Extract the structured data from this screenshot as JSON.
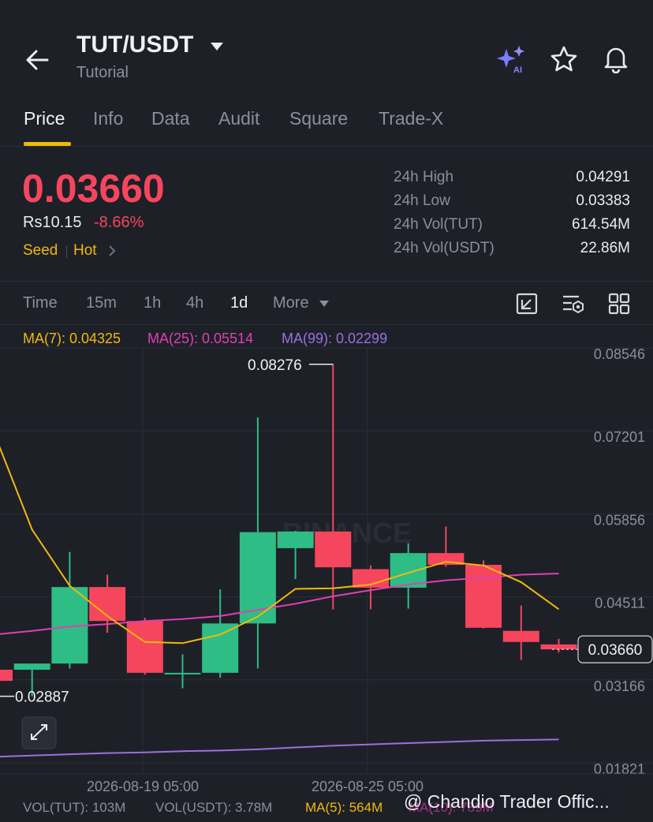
{
  "header": {
    "back_icon": "arrow-left-icon",
    "pair": "TUT/USDT",
    "subtitle": "Tutorial",
    "icons": [
      "ai-sparkle-icon",
      "star-icon",
      "bell-icon"
    ]
  },
  "tabs": [
    {
      "label": "Price",
      "active": true
    },
    {
      "label": "Info"
    },
    {
      "label": "Data"
    },
    {
      "label": "Audit"
    },
    {
      "label": "Square"
    },
    {
      "label": "Trade-X"
    }
  ],
  "price": {
    "last": "0.03660",
    "fiat": "Rs10.15",
    "change": "-8.66%",
    "tag_seed": "Seed",
    "tag_hot": "Hot"
  },
  "stats": [
    {
      "label": "24h High",
      "value": "0.04291"
    },
    {
      "label": "24h Low",
      "value": "0.03383"
    },
    {
      "label": "24h Vol(TUT)",
      "value": "614.54M"
    },
    {
      "label": "24h Vol(USDT)",
      "value": "22.86M"
    }
  ],
  "intervals": [
    {
      "label": "Time"
    },
    {
      "label": "15m"
    },
    {
      "label": "1h"
    },
    {
      "label": "4h"
    },
    {
      "label": "1d",
      "active": true
    },
    {
      "label": "More"
    }
  ],
  "ma_legend": {
    "ma7": "MA(7): 0.04325",
    "ma25": "MA(25): 0.05514",
    "ma99": "MA(99): 0.02299"
  },
  "colors": {
    "up": "#2ebd85",
    "down": "#f6465d",
    "ma7": "#f0b90b",
    "ma25": "#e040b0",
    "ma99": "#9b6fe0",
    "accent": "#f0b90b"
  },
  "chart_data": {
    "type": "candlestick",
    "y_ticks": [
      "0.08546",
      "0.07201",
      "0.05856",
      "0.04511",
      "0.03166",
      "0.01821"
    ],
    "x_ticks": [
      "2026-08-19 05:00",
      "2026-08-25 05:00"
    ],
    "ylim": [
      0.01821,
      0.08546
    ],
    "current_price_label": "0.03660",
    "high_label": "0.08276",
    "low_label": "0.02887",
    "watermark": "BINANCE",
    "candles": [
      {
        "o": 0.0333,
        "h": 0.0345,
        "l": 0.0315,
        "c": 0.0315
      },
      {
        "o": 0.0333,
        "h": 0.034,
        "l": 0.029,
        "c": 0.0343
      },
      {
        "o": 0.0343,
        "h": 0.0524,
        "l": 0.0335,
        "c": 0.0467
      },
      {
        "o": 0.0467,
        "h": 0.0487,
        "l": 0.0393,
        "c": 0.0412
      },
      {
        "o": 0.0412,
        "h": 0.0417,
        "l": 0.0325,
        "c": 0.0328
      },
      {
        "o": 0.0328,
        "h": 0.0358,
        "l": 0.0303,
        "c": 0.0328
      },
      {
        "o": 0.0328,
        "h": 0.0463,
        "l": 0.032,
        "c": 0.0408
      },
      {
        "o": 0.0408,
        "h": 0.0742,
        "l": 0.0335,
        "c": 0.0556
      },
      {
        "o": 0.053,
        "h": 0.0558,
        "l": 0.048,
        "c": 0.0557
      },
      {
        "o": 0.0557,
        "h": 0.0828,
        "l": 0.0431,
        "c": 0.0499
      },
      {
        "o": 0.0496,
        "h": 0.0502,
        "l": 0.0431,
        "c": 0.0466
      },
      {
        "o": 0.0466,
        "h": 0.0538,
        "l": 0.0432,
        "c": 0.0522
      },
      {
        "o": 0.0522,
        "h": 0.0565,
        "l": 0.05,
        "c": 0.0503
      },
      {
        "o": 0.0503,
        "h": 0.051,
        "l": 0.04,
        "c": 0.0401
      },
      {
        "o": 0.0396,
        "h": 0.0437,
        "l": 0.0349,
        "c": 0.0378
      },
      {
        "o": 0.0374,
        "h": 0.0383,
        "l": 0.0361,
        "c": 0.0366
      }
    ],
    "ma7": [
      0.0715,
      0.056,
      0.0469,
      0.042,
      0.0378,
      0.0376,
      0.039,
      0.0419,
      0.0464,
      0.0465,
      0.0471,
      0.049,
      0.0508,
      0.0502,
      0.0475,
      0.0431
    ],
    "ma25": [
      0.039,
      0.0396,
      0.0403,
      0.0407,
      0.0412,
      0.0415,
      0.042,
      0.043,
      0.044,
      0.0452,
      0.0462,
      0.0471,
      0.0478,
      0.0482,
      0.0487,
      0.0489
    ],
    "ma99": [
      0.0192,
      0.0194,
      0.0196,
      0.0198,
      0.0199,
      0.0201,
      0.0202,
      0.0204,
      0.0207,
      0.021,
      0.0212,
      0.0214,
      0.0216,
      0.0218,
      0.0219,
      0.022
    ]
  },
  "volume_legend": {
    "vol_tut": "VOL(TUT): 103M",
    "vol_usdt": "VOL(USDT): 3.78M",
    "ma5": "MA(5): 564M",
    "ma10": "MA(10): 789M"
  },
  "overlay_watermark": "@ Chandio Trader Offic..."
}
